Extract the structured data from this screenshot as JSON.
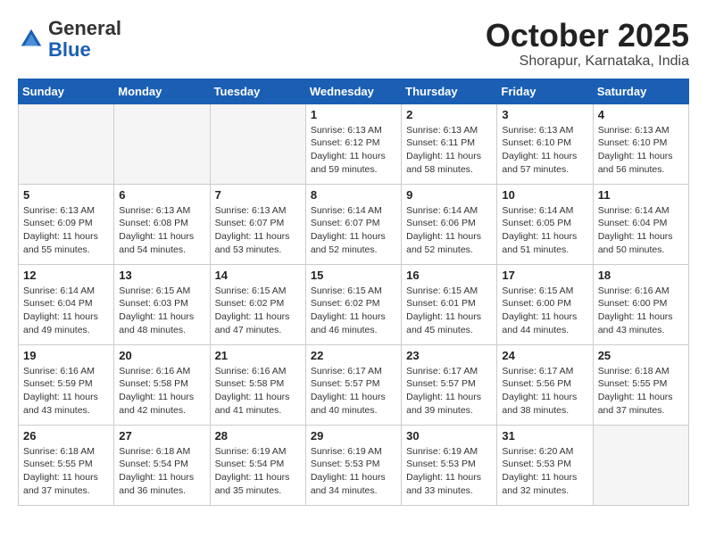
{
  "header": {
    "logo_line1": "General",
    "logo_line2": "Blue",
    "month_title": "October 2025",
    "location": "Shorapur, Karnataka, India"
  },
  "weekdays": [
    "Sunday",
    "Monday",
    "Tuesday",
    "Wednesday",
    "Thursday",
    "Friday",
    "Saturday"
  ],
  "weeks": [
    [
      {
        "day": "",
        "empty": true
      },
      {
        "day": "",
        "empty": true
      },
      {
        "day": "",
        "empty": true
      },
      {
        "day": "1",
        "sunrise": "6:13 AM",
        "sunset": "6:12 PM",
        "daylight": "11 hours and 59 minutes."
      },
      {
        "day": "2",
        "sunrise": "6:13 AM",
        "sunset": "6:11 PM",
        "daylight": "11 hours and 58 minutes."
      },
      {
        "day": "3",
        "sunrise": "6:13 AM",
        "sunset": "6:10 PM",
        "daylight": "11 hours and 57 minutes."
      },
      {
        "day": "4",
        "sunrise": "6:13 AM",
        "sunset": "6:10 PM",
        "daylight": "11 hours and 56 minutes."
      }
    ],
    [
      {
        "day": "5",
        "sunrise": "6:13 AM",
        "sunset": "6:09 PM",
        "daylight": "11 hours and 55 minutes."
      },
      {
        "day": "6",
        "sunrise": "6:13 AM",
        "sunset": "6:08 PM",
        "daylight": "11 hours and 54 minutes."
      },
      {
        "day": "7",
        "sunrise": "6:13 AM",
        "sunset": "6:07 PM",
        "daylight": "11 hours and 53 minutes."
      },
      {
        "day": "8",
        "sunrise": "6:14 AM",
        "sunset": "6:07 PM",
        "daylight": "11 hours and 52 minutes."
      },
      {
        "day": "9",
        "sunrise": "6:14 AM",
        "sunset": "6:06 PM",
        "daylight": "11 hours and 52 minutes."
      },
      {
        "day": "10",
        "sunrise": "6:14 AM",
        "sunset": "6:05 PM",
        "daylight": "11 hours and 51 minutes."
      },
      {
        "day": "11",
        "sunrise": "6:14 AM",
        "sunset": "6:04 PM",
        "daylight": "11 hours and 50 minutes."
      }
    ],
    [
      {
        "day": "12",
        "sunrise": "6:14 AM",
        "sunset": "6:04 PM",
        "daylight": "11 hours and 49 minutes."
      },
      {
        "day": "13",
        "sunrise": "6:15 AM",
        "sunset": "6:03 PM",
        "daylight": "11 hours and 48 minutes."
      },
      {
        "day": "14",
        "sunrise": "6:15 AM",
        "sunset": "6:02 PM",
        "daylight": "11 hours and 47 minutes."
      },
      {
        "day": "15",
        "sunrise": "6:15 AM",
        "sunset": "6:02 PM",
        "daylight": "11 hours and 46 minutes."
      },
      {
        "day": "16",
        "sunrise": "6:15 AM",
        "sunset": "6:01 PM",
        "daylight": "11 hours and 45 minutes."
      },
      {
        "day": "17",
        "sunrise": "6:15 AM",
        "sunset": "6:00 PM",
        "daylight": "11 hours and 44 minutes."
      },
      {
        "day": "18",
        "sunrise": "6:16 AM",
        "sunset": "6:00 PM",
        "daylight": "11 hours and 43 minutes."
      }
    ],
    [
      {
        "day": "19",
        "sunrise": "6:16 AM",
        "sunset": "5:59 PM",
        "daylight": "11 hours and 43 minutes."
      },
      {
        "day": "20",
        "sunrise": "6:16 AM",
        "sunset": "5:58 PM",
        "daylight": "11 hours and 42 minutes."
      },
      {
        "day": "21",
        "sunrise": "6:16 AM",
        "sunset": "5:58 PM",
        "daylight": "11 hours and 41 minutes."
      },
      {
        "day": "22",
        "sunrise": "6:17 AM",
        "sunset": "5:57 PM",
        "daylight": "11 hours and 40 minutes."
      },
      {
        "day": "23",
        "sunrise": "6:17 AM",
        "sunset": "5:57 PM",
        "daylight": "11 hours and 39 minutes."
      },
      {
        "day": "24",
        "sunrise": "6:17 AM",
        "sunset": "5:56 PM",
        "daylight": "11 hours and 38 minutes."
      },
      {
        "day": "25",
        "sunrise": "6:18 AM",
        "sunset": "5:55 PM",
        "daylight": "11 hours and 37 minutes."
      }
    ],
    [
      {
        "day": "26",
        "sunrise": "6:18 AM",
        "sunset": "5:55 PM",
        "daylight": "11 hours and 37 minutes."
      },
      {
        "day": "27",
        "sunrise": "6:18 AM",
        "sunset": "5:54 PM",
        "daylight": "11 hours and 36 minutes."
      },
      {
        "day": "28",
        "sunrise": "6:19 AM",
        "sunset": "5:54 PM",
        "daylight": "11 hours and 35 minutes."
      },
      {
        "day": "29",
        "sunrise": "6:19 AM",
        "sunset": "5:53 PM",
        "daylight": "11 hours and 34 minutes."
      },
      {
        "day": "30",
        "sunrise": "6:19 AM",
        "sunset": "5:53 PM",
        "daylight": "11 hours and 33 minutes."
      },
      {
        "day": "31",
        "sunrise": "6:20 AM",
        "sunset": "5:53 PM",
        "daylight": "11 hours and 32 minutes."
      },
      {
        "day": "",
        "empty": true
      }
    ]
  ]
}
